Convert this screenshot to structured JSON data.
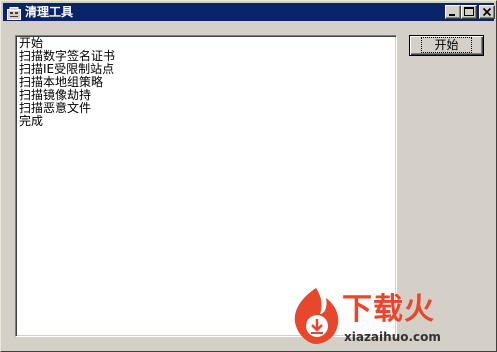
{
  "window": {
    "title": "清理工具",
    "icon": "app-icon",
    "caption_buttons": [
      "minimize-icon",
      "maximize-icon",
      "close-icon"
    ]
  },
  "log": {
    "lines": [
      "开始",
      "扫描数字签名证书",
      "扫描IE受限制站点",
      "扫描本地组策略",
      "扫描镜像劫持",
      "扫描恶意文件",
      "完成"
    ]
  },
  "actions": {
    "start_label": "开始"
  },
  "watermark": {
    "brand": "下载火",
    "url": "xiazaihuo.com",
    "brand_color": "#e8472b"
  }
}
